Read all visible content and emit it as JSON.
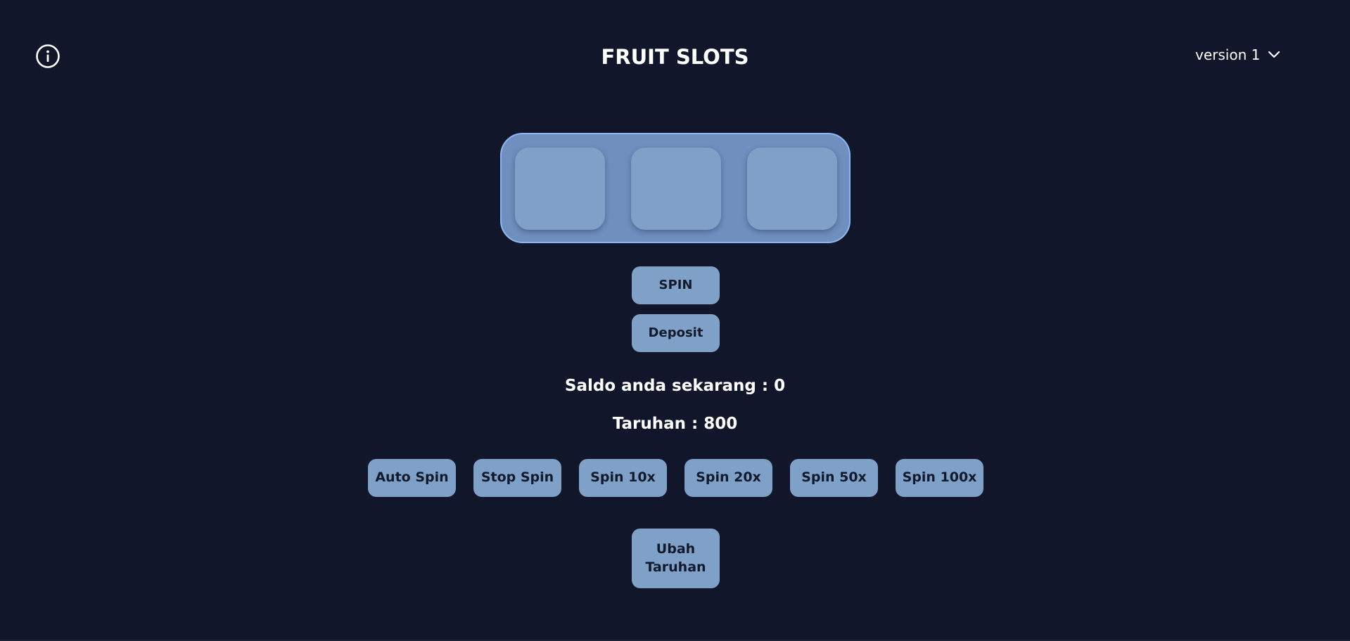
{
  "header": {
    "title": "FRUIT SLOTS",
    "info_icon": "info-circle-icon",
    "version_label": "version 1",
    "version_icon": "chevron-down-icon"
  },
  "reels": {
    "symbols": [
      "",
      "",
      ""
    ]
  },
  "actions": {
    "spin_label": "SPIN",
    "deposit_label": "Deposit"
  },
  "status": {
    "saldo_text": "Saldo anda sekarang : 0",
    "taruhan_text": "Taruhan : 800"
  },
  "spin_options": [
    {
      "label": "Auto Spin"
    },
    {
      "label": "Stop Spin"
    },
    {
      "label": "Spin 10x"
    },
    {
      "label": "Spin 20x"
    },
    {
      "label": "Spin 50x"
    },
    {
      "label": "Spin 100x"
    }
  ],
  "ubah_taruhan_label": "Ubah Taruhan",
  "colors": {
    "background": "#11162a",
    "button": "#7fa1c7",
    "reel_frame": "#6f8fbf",
    "reel_border": "#8fb6f2",
    "button_text": "#111a2c"
  }
}
